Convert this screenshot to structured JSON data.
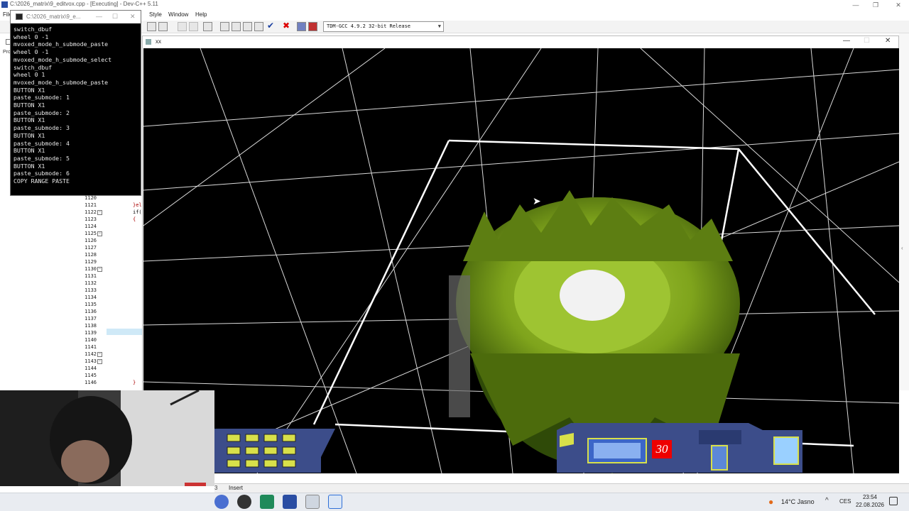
{
  "ide": {
    "title": "C:\\2026_matrix\\9_editvox.cpp - [Executing] - Dev-C++ 5.11",
    "menu": [
      "File",
      "Style",
      "Window",
      "Help"
    ],
    "project_label": "Pro",
    "compiler": "TDM-GCC 4.9.2 32-bit Release",
    "line_numbers": [
      "1120",
      "1121",
      "1122",
      "1123",
      "1124",
      "1125",
      "1126",
      "1127",
      "1128",
      "1129",
      "1130",
      "1131",
      "1132",
      "1133",
      "1134",
      "1135",
      "1136",
      "1137",
      "1138",
      "1139",
      "1140",
      "1141",
      "1142",
      "1143",
      "1144",
      "1145",
      "1146"
    ],
    "code_fragments": [
      "}el",
      "if(",
      "{",
      "}"
    ],
    "status_line": "3",
    "status_mode": "Insert"
  },
  "console": {
    "title": "C:\\2026_matrix\\9_e...",
    "output": "switch_dbuf\nwheel 0 -1\nmvoxed_mode_h_submode_paste\nwheel 0 -1\nmvoxed_mode_h_submode_select\nswitch_dbuf\nwheel 0 1\nmvoxed_mode_h_submode_paste\nBUTTON X1\npaste_submode: 1\nBUTTON X1\npaste_submode: 2\nBUTTON X1\npaste_submode: 3\nBUTTON X1\npaste_submode: 4\nBUTTON X1\npaste_submode: 5\nBUTTON X1\npaste_submode: 6\nCOPY RANGE PASTE"
  },
  "game_window": {
    "title": "xx",
    "hud_counter": "30"
  },
  "taskbar": {
    "weather": "14°C  Jasno",
    "language": "CES",
    "time": "23:54",
    "date": "22.08.2026"
  },
  "colors": {
    "voxel_green": "#7fa41c",
    "voxel_light": "#a6c93a",
    "grid_line": "#ffffff",
    "hud_blue": "#3c4d8a",
    "hud_yellow": "#d8e04a",
    "counter_red": "#e00000"
  }
}
